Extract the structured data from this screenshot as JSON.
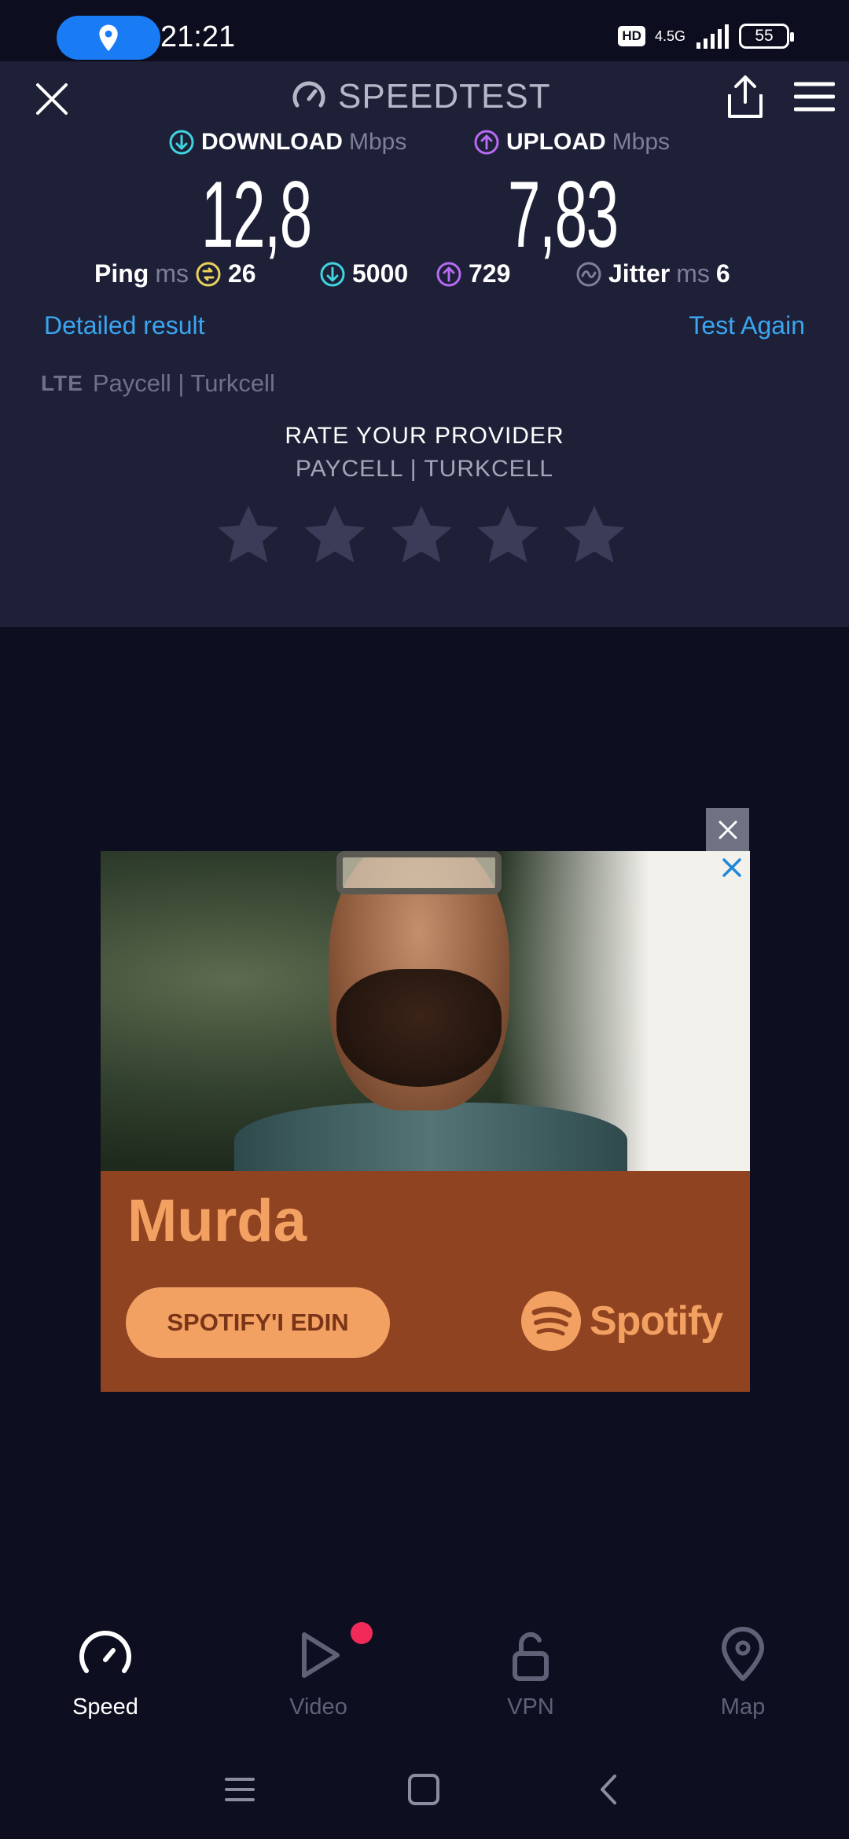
{
  "status_bar": {
    "time": "21:21",
    "hd_badge": "HD",
    "network": "4.5G",
    "battery": "55",
    "location_icon": "location-pin-icon"
  },
  "header": {
    "title": "SPEEDTEST",
    "close_icon": "close-icon",
    "logo_icon": "speedometer-icon",
    "share_icon": "share-icon",
    "menu_icon": "hamburger-menu-icon"
  },
  "results": {
    "download": {
      "label": "DOWNLOAD",
      "unit": "Mbps",
      "value": "12,8",
      "color": "#3fd4e0"
    },
    "upload": {
      "label": "UPLOAD",
      "unit": "Mbps",
      "value": "7,83",
      "color": "#b66bf2"
    },
    "ping": {
      "label": "Ping",
      "unit": "ms",
      "value": "26",
      "color": "#e9d25c"
    },
    "ping_download": "5000",
    "ping_upload": "729",
    "jitter": {
      "label": "Jitter",
      "unit": "ms",
      "value": "6"
    }
  },
  "links": {
    "detailed": "Detailed result",
    "test_again": "Test Again"
  },
  "provider": {
    "tech": "LTE",
    "name": "Paycell | Turkcell"
  },
  "rating": {
    "title": "RATE YOUR PROVIDER",
    "provider": "PAYCELL | TURKCELL",
    "stars_total": 5,
    "stars_filled": 0
  },
  "ad": {
    "artist": "Murda",
    "cta": "SPOTIFY'I EDIN",
    "brand": "Spotify",
    "accent": "#f3a162",
    "background": "#8f4321"
  },
  "bottom_nav": {
    "items": [
      {
        "label": "Speed",
        "icon": "speedometer-icon",
        "active": true
      },
      {
        "label": "Video",
        "icon": "play-icon",
        "active": false
      },
      {
        "label": "VPN",
        "icon": "unlock-icon",
        "active": false
      },
      {
        "label": "Map",
        "icon": "map-pin-icon",
        "active": false
      }
    ]
  }
}
